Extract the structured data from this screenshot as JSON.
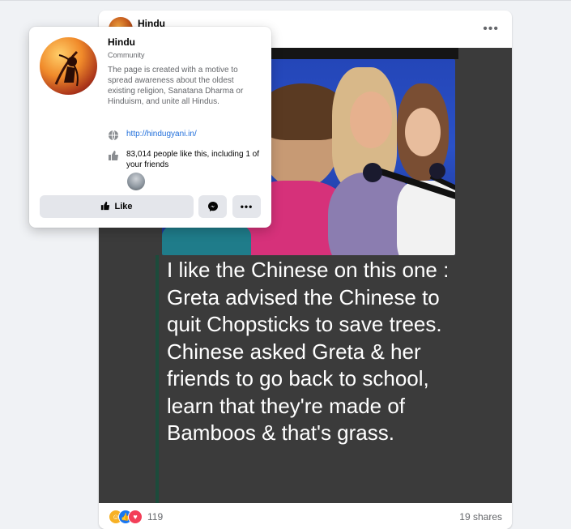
{
  "post": {
    "page_name": "Hindu",
    "more_icon": "more-horizontal-icon",
    "image_text": "I like the Chinese on this one :\nGreta advised the Chinese to quit Chopsticks to save trees.\nChinese asked Greta & her friends to go back to school, learn that they're made of Bamboos & that's grass.",
    "reaction_icons": [
      "haha-icon",
      "like-icon",
      "love-icon"
    ],
    "reaction_count": "119",
    "shares": "19 shares"
  },
  "hover_card": {
    "name": "Hindu",
    "category": "Community",
    "description": "The page is created with a motive to spread awareness about the oldest existing religion, Sanatana Dharma or Hinduism, and unite all Hindus.",
    "website": "http://hindugyani.in/",
    "likes_text": "83,014 people like this, including 1 of your friends",
    "like_button": "Like",
    "colors": {
      "link": "#216fdb",
      "button_bg": "#e4e6eb",
      "messenger": "#050505"
    }
  }
}
